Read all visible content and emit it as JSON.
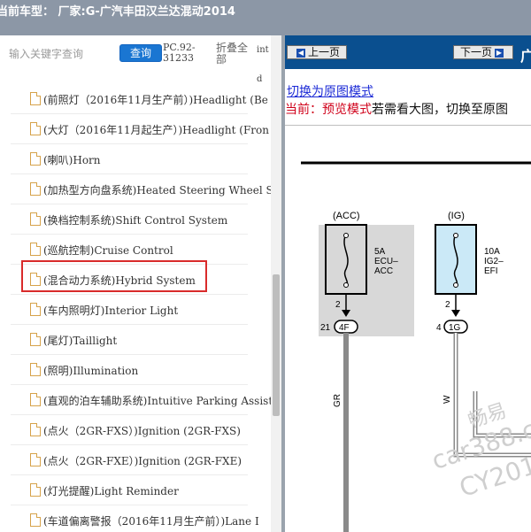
{
  "header": {
    "title": "当前车型：  厂家:G-广汽丰田汉兰达混动2014"
  },
  "sidebar": {
    "search_placeholder": "输入关键字查询",
    "query_label": "查询",
    "pc_code_line1": "PC.92-",
    "pc_code_line2": "31233",
    "collapse_line1": "折叠全",
    "collapse_line2": "部",
    "frag_a": "int",
    "frag_b": "d",
    "items": [
      {
        "label": "(前照灯（2016年11月生产前）)Headlight (Be"
      },
      {
        "label": "(大灯（2016年11月起生产）)Headlight (Fron"
      },
      {
        "label": "(喇叭)Horn"
      },
      {
        "label": "(加热型方向盘系统)Heated Steering Wheel Sy"
      },
      {
        "label": "(换档控制系统)Shift Control System"
      },
      {
        "label": "(巡航控制)Cruise Control"
      },
      {
        "label": "(混合动力系统)Hybrid System"
      },
      {
        "label": "(车内照明灯)Interior Light"
      },
      {
        "label": "(尾灯)Taillight"
      },
      {
        "label": "(照明)Illumination"
      },
      {
        "label": "(直观的泊车辅助系统)Intuitive Parking Assist"
      },
      {
        "label": "(点火（2GR-FXS）)Ignition (2GR-FXS)"
      },
      {
        "label": "(点火（2GR-FXE）)Ignition (2GR-FXE)"
      },
      {
        "label": "(灯光提醒)Light Reminder"
      },
      {
        "label": "(车道偏离警报（2016年11月生产前）)Lane I"
      }
    ]
  },
  "viewer": {
    "prev_label": "上一页",
    "next_label": "下一页",
    "nav_fragment": "广",
    "switch_link": "切换为原图模式",
    "current_prefix": "当前：预览模式",
    "current_suffix": "若需看大图，切换至原图"
  },
  "diagram": {
    "acc_label": "(ACC)",
    "ig_label": "(IG)",
    "fuse1_amp": "5A",
    "fuse1_name1": "ECU–",
    "fuse1_name2": "ACC",
    "fuse2_amp": "10A",
    "fuse2_name1": "IG2–",
    "fuse2_name2": "EFI",
    "pin_acc": "2",
    "pin_ig": "2",
    "conn1_pin": "21",
    "conn1_id": "4F",
    "conn2_pin": "4",
    "conn2_id": "1G",
    "wire1": "GR",
    "wire2": "W",
    "watermark1": "畅易",
    "watermark2": "car388.c",
    "watermark3": "CY201"
  },
  "colors": {
    "highlight": "#d92b2b",
    "fuse_acc_bg": "#d8d8d8",
    "fuse_ig_bg": "#cbe9f7",
    "wire": "#8a8a8a"
  }
}
